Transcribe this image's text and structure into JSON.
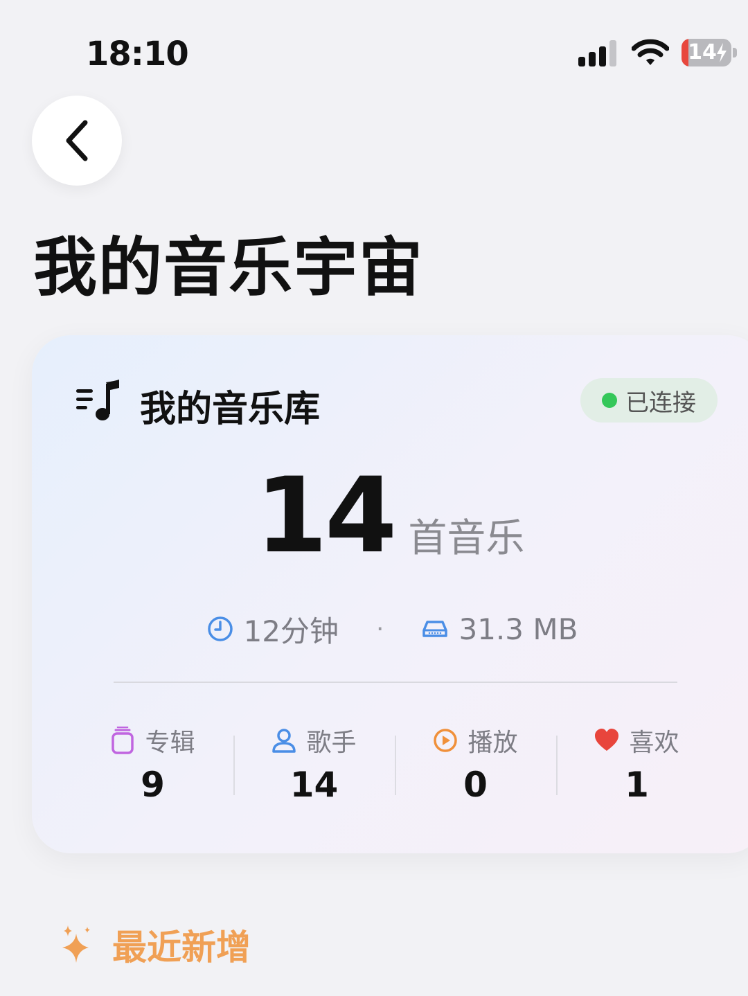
{
  "status_bar": {
    "time": "18:10",
    "battery_level": "14",
    "battery_fraction": 0.14,
    "battery_color": "#e8473d"
  },
  "navigation": {
    "back_icon": "chevron-left-icon"
  },
  "page": {
    "title": "我的音乐宇宙"
  },
  "library_card": {
    "icon": "music-list-icon",
    "title": "我的音乐库",
    "connection_status": "已连接",
    "connection_color": "#34c759",
    "song_count": "14",
    "song_unit": "首音乐",
    "duration": "12分钟",
    "duration_icon": "clock-icon",
    "separator": "·",
    "size": "31.3 MB",
    "size_icon": "storage-icon",
    "stats": [
      {
        "icon": "album-icon",
        "label": "专辑",
        "value": "9",
        "color": "#c065e0"
      },
      {
        "icon": "person-icon",
        "label": "歌手",
        "value": "14",
        "color": "#4a8ee6"
      },
      {
        "icon": "play-circle-icon",
        "label": "播放",
        "value": "0",
        "color": "#f0903a"
      },
      {
        "icon": "heart-icon",
        "label": "喜欢",
        "value": "1",
        "color": "#e8453c"
      }
    ]
  },
  "recent_section": {
    "icon": "sparkles-icon",
    "title": "最近新增",
    "accent_color": "#f0a055"
  }
}
